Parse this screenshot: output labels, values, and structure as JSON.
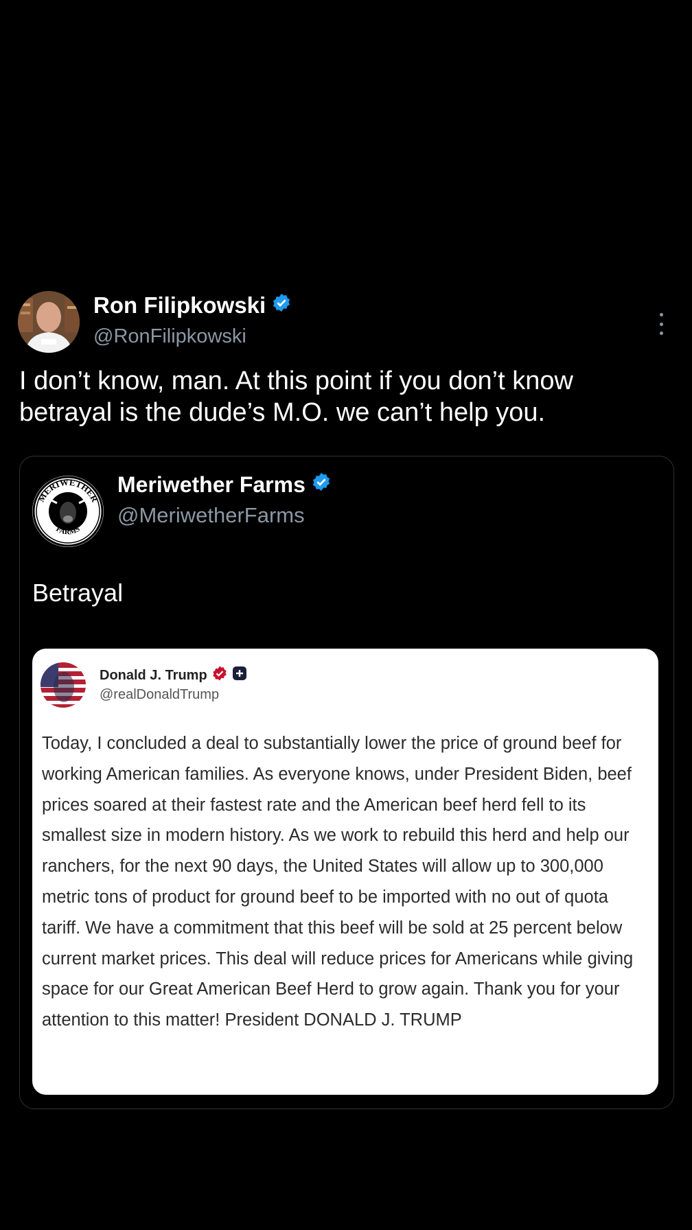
{
  "tweet": {
    "author_name": "Ron Filipkowski",
    "author_handle": "@RonFilipkowski",
    "text": "I don’t know, man. At this point if you don’t know betrayal is the dude’s M.O. we can’t help you."
  },
  "quoted": {
    "author_name": "Meriwether Farms",
    "author_handle": "@MeriwetherFarms",
    "text": "Betrayal",
    "logo_top": "MERIWETHER",
    "logo_bottom": "FARMS"
  },
  "embedded": {
    "author_name": "Donald J. Trump",
    "author_handle": "@realDonaldTrump",
    "body": "Today, I concluded a deal to substantially lower the price of ground beef for working American families. As everyone knows, under President Biden, beef prices soared at their fastest rate and the American beef herd fell to its smallest size in modern history.  As we work to rebuild this herd and help our ranchers, for the next 90 days, the United States will allow up to 300,000 metric tons of product for ground beef to be imported with no out of quota tariff.  We have a commitment that this beef will be sold at 25 percent below current market prices. This deal will reduce prices for Americans while giving space for our Great American Beef Herd to grow again. Thank you for your attention to this matter! President DONALD J. TRUMP"
  },
  "colors": {
    "background": "#000000",
    "verified_blue": "#1d9bf0",
    "verified_red": "#c8102e",
    "secondary_text": "#8b98a5"
  }
}
